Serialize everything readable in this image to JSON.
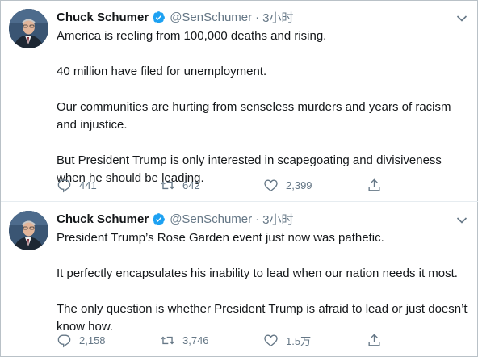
{
  "tweets": [
    {
      "author_name": "Chuck Schumer",
      "handle": "@SenSchumer",
      "separator": "·",
      "time": "3小时",
      "paragraphs": [
        "America is reeling from 100,000 deaths and rising.",
        "40 million have filed for unemployment.",
        "Our communities are hurting from senseless murders and years of racism and injustice.",
        "But President Trump is only interested in scapegoating and divisiveness when he should be leading."
      ],
      "reply_count": "441",
      "retweet_count": "642",
      "like_count": "2,399"
    },
    {
      "author_name": "Chuck Schumer",
      "handle": "@SenSchumer",
      "separator": "·",
      "time": "3小时",
      "paragraphs": [
        "President Trump’s Rose Garden event just now was pathetic.",
        "It perfectly encapsulates his inability to lead when our nation needs it most.",
        "The only question is whether President Trump is afraid to lead or just doesn’t know how."
      ],
      "reply_count": "2,158",
      "retweet_count": "3,746",
      "like_count": "1.5万"
    }
  ],
  "icons": {
    "verified": "verified-badge-icon",
    "more": "chevron-down-icon",
    "reply": "reply-icon",
    "retweet": "retweet-icon",
    "like": "heart-icon",
    "share": "share-icon"
  },
  "colors": {
    "text": "#14171a",
    "secondary": "#657786",
    "verified": "#1da1f2",
    "divider": "#e6ecf0"
  }
}
